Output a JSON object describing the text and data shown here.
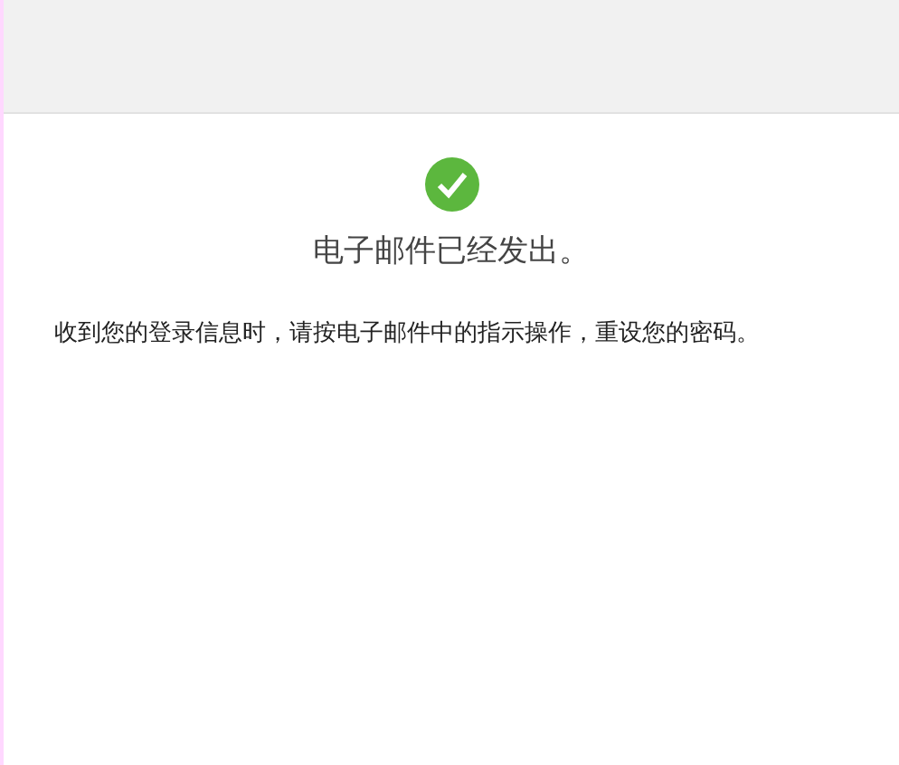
{
  "title": "电子邮件已经发出。",
  "message": "收到您的登录信息时，请按电子邮件中的指示操作，重设您的密码。"
}
